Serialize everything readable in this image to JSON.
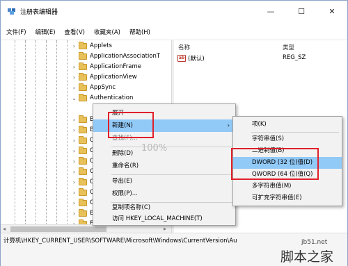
{
  "window": {
    "title": "注册表编辑器",
    "minimize": "—",
    "maximize": "☐",
    "close": "✕"
  },
  "menu": [
    "文件(F)",
    "编辑(E)",
    "查看(V)",
    "收藏夹(A)",
    "帮助(H)"
  ],
  "tree": [
    {
      "label": "Applets",
      "expander": "›"
    },
    {
      "label": "ApplicationAssociationT",
      "expander": ""
    },
    {
      "label": "ApplicationFrame",
      "expander": "›"
    },
    {
      "label": "ApplicationView",
      "expander": "›"
    },
    {
      "label": "AppSync",
      "expander": "›"
    },
    {
      "label": "Authentication",
      "expander": "⌄"
    }
  ],
  "tree_partial": [
    "B",
    "B",
    "C",
    "C",
    "C",
    "C",
    "C",
    "C",
    "C",
    "E",
    "E",
    "E"
  ],
  "list": {
    "col_name": "名称",
    "col_type": "类型",
    "row_icon": "ab",
    "row_name": "(默认)",
    "row_type": "REG_SZ"
  },
  "context_menu": [
    {
      "label": "展开",
      "style": ""
    },
    {
      "label": "新建(N)",
      "style": "hl",
      "submenu": "›"
    },
    {
      "label": "查找(F)...",
      "style": ""
    },
    {
      "label": "删除(D)",
      "style": ""
    },
    {
      "label": "重命名(R)",
      "style": ""
    },
    {
      "label": "导出(E)",
      "style": ""
    },
    {
      "label": "权限(P)...",
      "style": ""
    },
    {
      "label": "复制项名称(C)",
      "style": ""
    },
    {
      "label": "访问 HKEY_LOCAL_MACHINE(T)",
      "style": ""
    }
  ],
  "zoom_overlay": "100%",
  "submenu": [
    {
      "label": "项(K)",
      "style": ""
    },
    {
      "label": "字符串值(S)",
      "style": ""
    },
    {
      "label": "二进制值(B)",
      "style": ""
    },
    {
      "label": "DWORD (32 位)值(D)",
      "style": "hl"
    },
    {
      "label": "QWORD (64 位)值(Q)",
      "style": ""
    },
    {
      "label": "多字符串值(M)",
      "style": ""
    },
    {
      "label": "可扩充字符串值(E)",
      "style": ""
    }
  ],
  "status": "计算机\\HKEY_CURRENT_USER\\SOFTWARE\\Microsoft\\Windows\\CurrentVersion\\Au",
  "watermark": {
    "site": "jb51.net",
    "name": "脚本之家"
  }
}
